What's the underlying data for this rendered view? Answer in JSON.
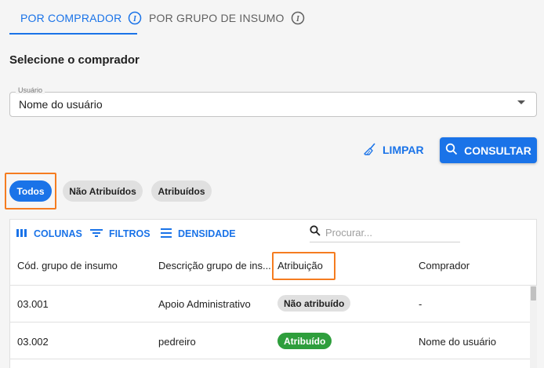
{
  "tabs": [
    {
      "label": "POR COMPRADOR",
      "active": true,
      "icon": "info-icon"
    },
    {
      "label": "POR GRUPO DE INSUMO",
      "active": false,
      "icon": "info-icon"
    }
  ],
  "section_title": "Selecione o comprador",
  "buyer_select": {
    "legend": "Usuário",
    "value": "Nome do usuário",
    "icon": "chevron-down-icon"
  },
  "actions": {
    "limpar": {
      "label": "LIMPAR",
      "icon": "broom-icon"
    },
    "consultar": {
      "label": "CONSULTAR",
      "icon": "search-icon"
    }
  },
  "filters": [
    {
      "label": "Todos",
      "selected": true
    },
    {
      "label": "Não Atribuídos",
      "selected": false
    },
    {
      "label": "Atribuídos",
      "selected": false
    }
  ],
  "grid_toolbar": {
    "columns_label": "COLUNAS",
    "filters_label": "FILTROS",
    "density_label": "DENSIDADE",
    "search_placeholder": "Procurar..."
  },
  "table": {
    "headers": [
      "Cód. grupo de insumo",
      "Descrição grupo de ins...",
      "Atribuição",
      "Comprador"
    ],
    "rows": [
      {
        "code": "03.001",
        "description": "Apoio Administrativo",
        "assignment": "Não atribuído",
        "assigned": false,
        "buyer": "-"
      },
      {
        "code": "03.002",
        "description": "pedreiro",
        "assignment": "Atribuído",
        "assigned": true,
        "buyer": "Nome do usuário"
      }
    ]
  },
  "colors": {
    "primary": "#1a73e8",
    "highlight": "#f57c20",
    "assigned_green": "#2e9e3c",
    "chip_grey": "#e0e0e0"
  }
}
